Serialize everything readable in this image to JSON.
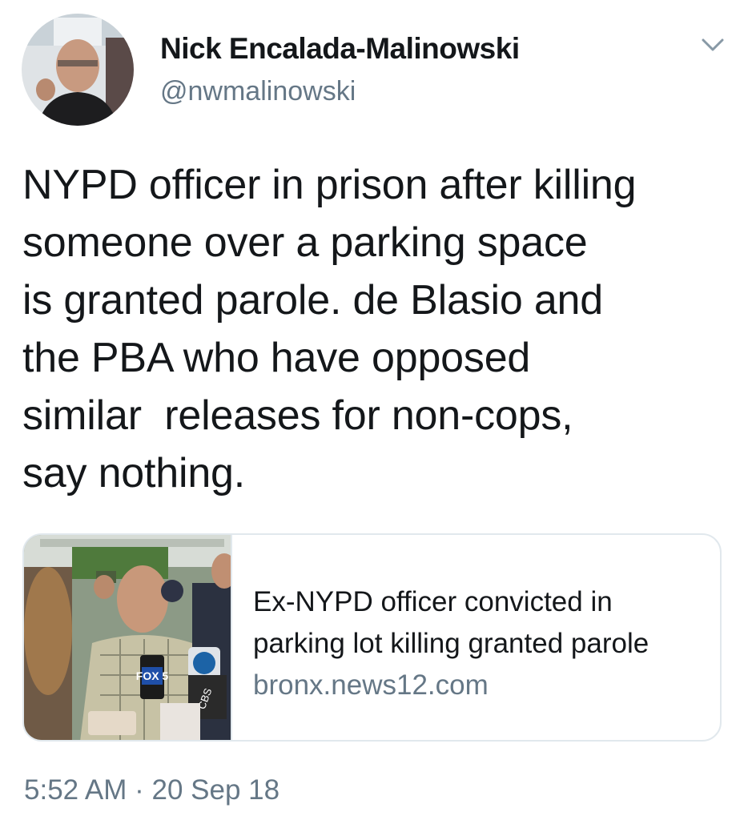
{
  "author": {
    "display_name": "Nick Encalada-Malinowski",
    "handle": "@nwmalinowski",
    "avatar_icon": "profile-photo"
  },
  "tweet": {
    "text": "NYPD officer in prison after killing\nsomeone over a parking space\nis granted parole. de Blasio and\nthe PBA who have opposed\nsimilar  releases for non-cops,\nsay nothing.",
    "menu_icon": "chevron-down-icon"
  },
  "card": {
    "title": "Ex-NYPD officer convicted in parking lot killing granted parole",
    "domain": "bronx.news12.com",
    "image_icon": "news-press-conference-photo",
    "mic_flag_1": "FOX 5",
    "mic_flag_2": "CBS"
  },
  "meta": {
    "timestamp": "5:52 AM · 20 Sep 18"
  },
  "colors": {
    "text_primary": "#14171a",
    "text_secondary": "#657786",
    "border": "#e1e8ed"
  }
}
